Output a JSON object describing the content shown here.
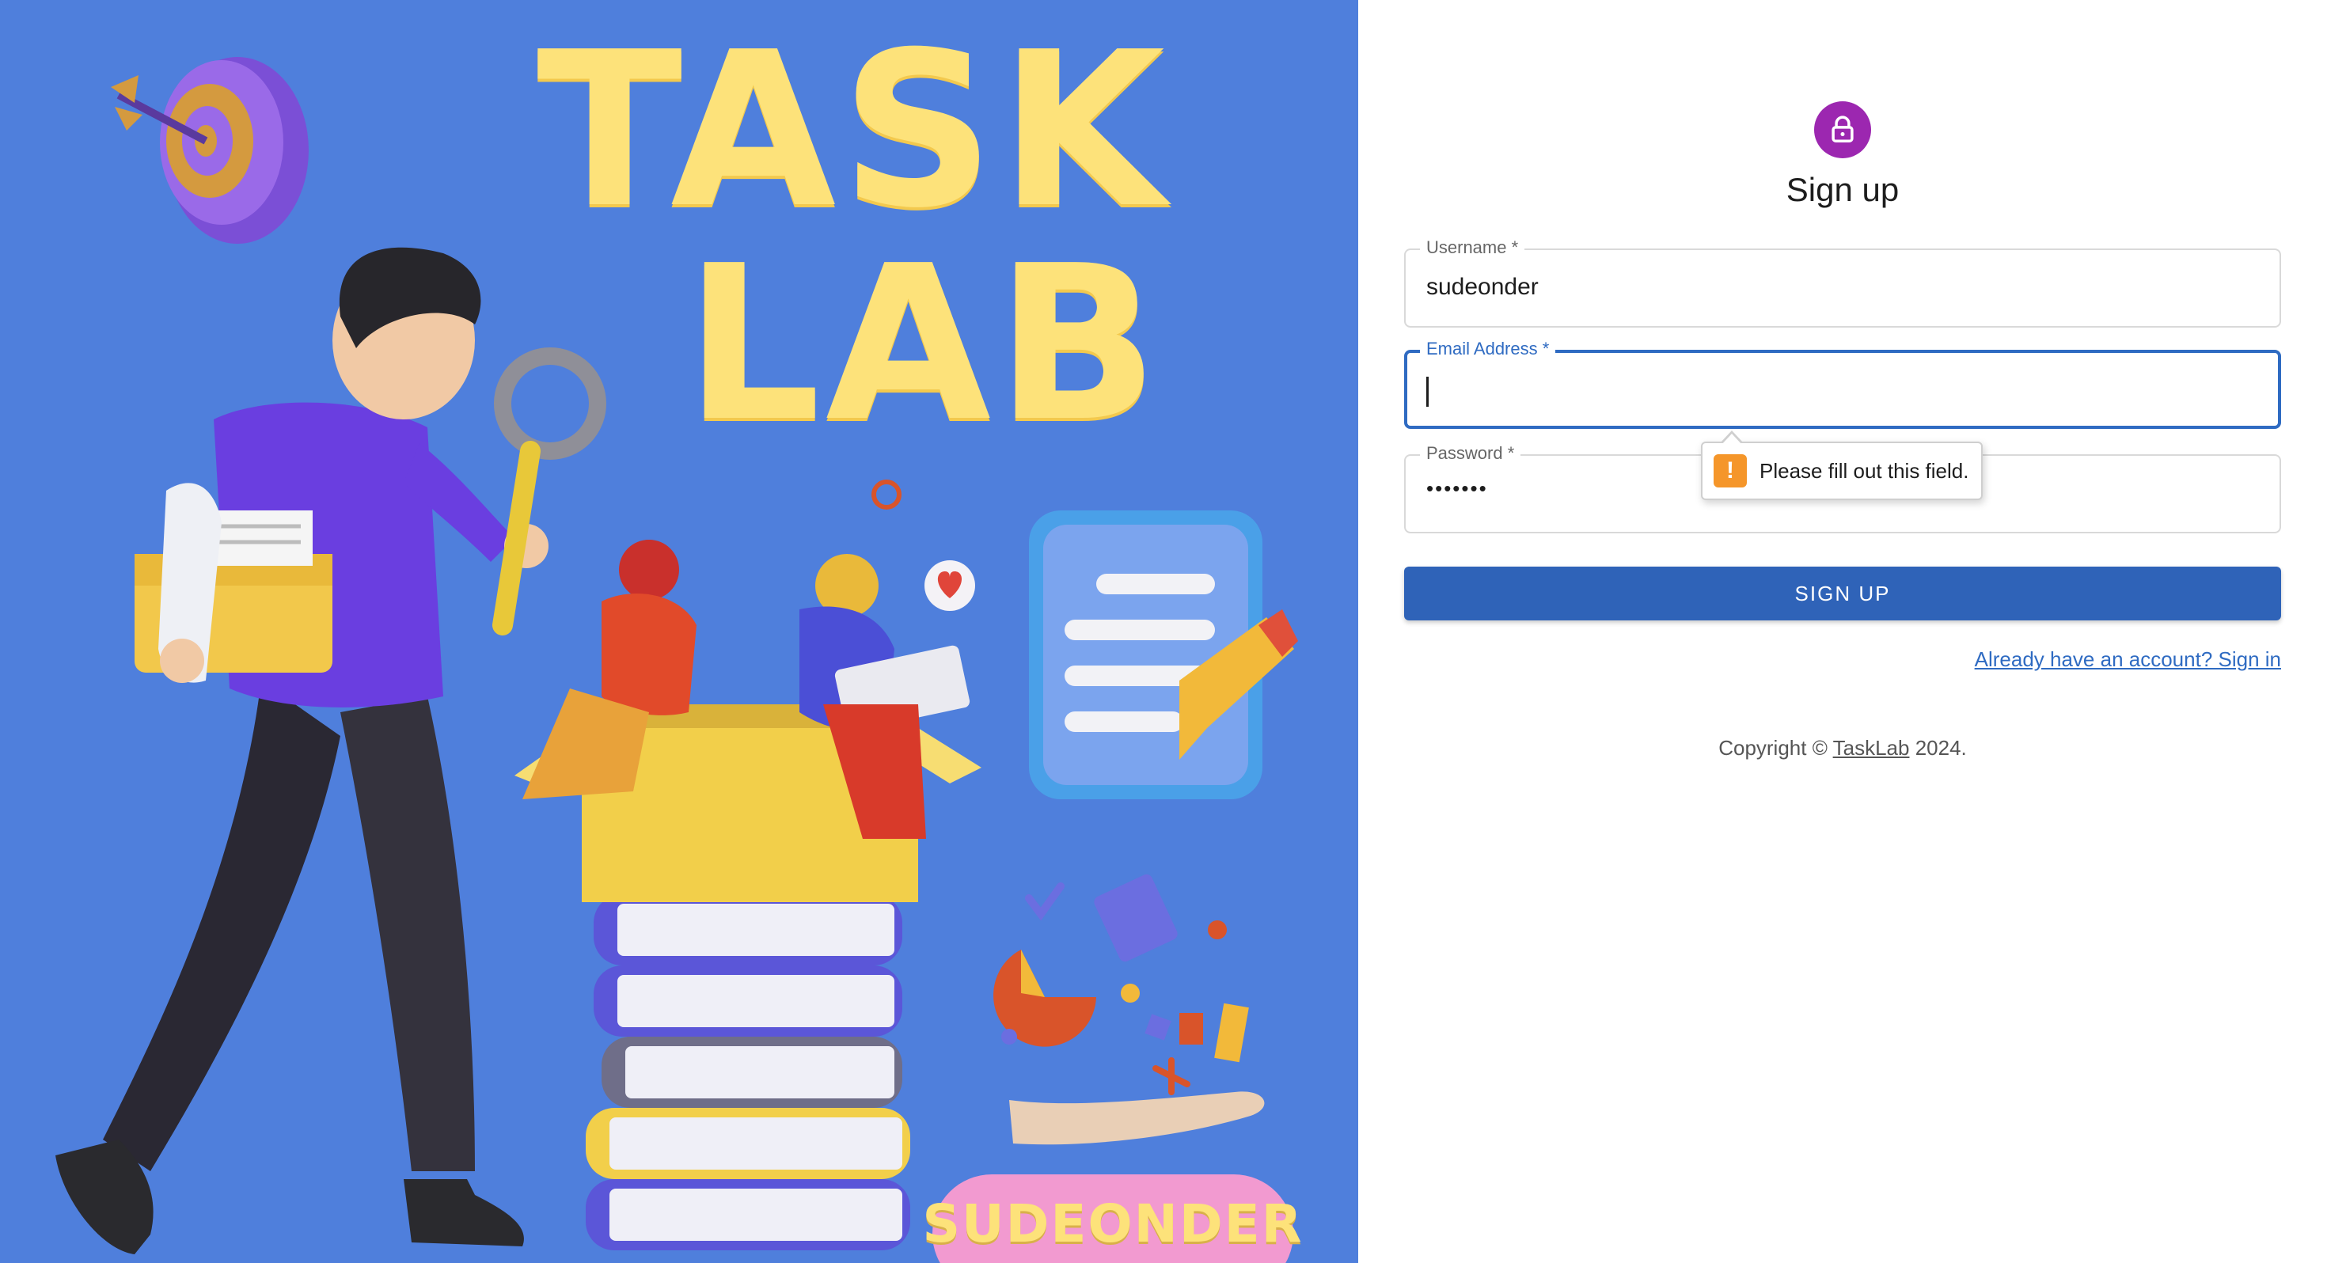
{
  "hero": {
    "title_line1": "TASK",
    "title_line2": "LAB",
    "badge": "SUDEONDER",
    "background": "#4f7fdc",
    "title_color": "#fde27a"
  },
  "form": {
    "icon": "lock-icon",
    "avatar_color": "#9c27b0",
    "title": "Sign up",
    "username": {
      "label": "Username *",
      "value": "sudeonder"
    },
    "email": {
      "label": "Email Address *",
      "value": ""
    },
    "password": {
      "label": "Password *",
      "masked_value": "•••••••"
    },
    "validation": {
      "icon": "warning-icon",
      "message": "Please fill out this field."
    },
    "submit_label": "SIGN UP",
    "submit_color": "#2f63b8",
    "signin_link": "Already have an account? Sign in",
    "copyright_prefix": "Copyright ©",
    "copyright_brand": "TaskLab",
    "copyright_suffix": "2024."
  }
}
